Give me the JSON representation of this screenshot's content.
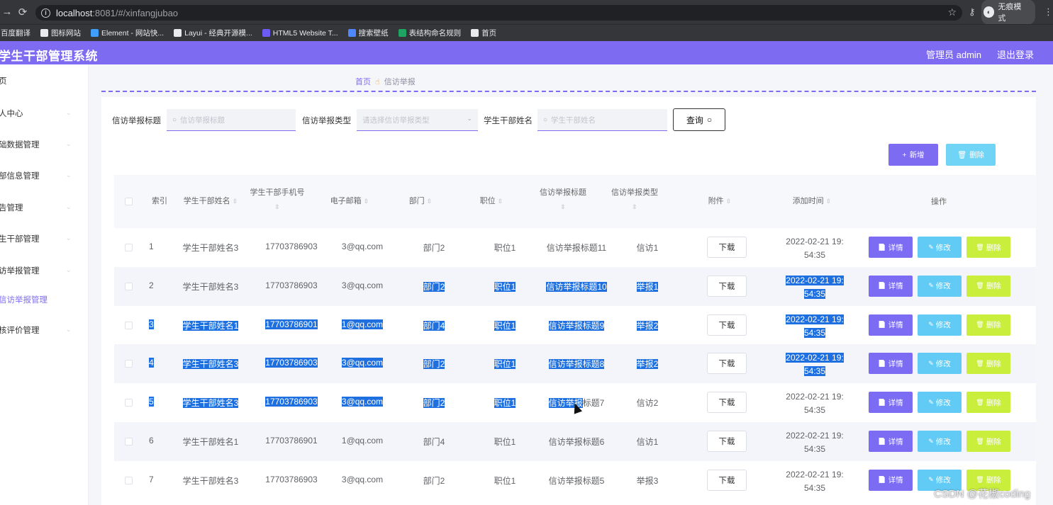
{
  "browser": {
    "url_host": "localhost",
    "url_path": ":8081/#/xinfangjubao",
    "profile_label": "无痕模式",
    "bookmarks": [
      {
        "label": "百度翻译",
        "icon": "translate-icon",
        "color": "#e8eaed"
      },
      {
        "label": "图标网站",
        "icon": "flag-icon",
        "color": "#e8eaed"
      },
      {
        "label": "Element - 网站快...",
        "icon": "element-icon",
        "color": "#409eff"
      },
      {
        "label": "Layui - 经典开源模...",
        "icon": "layui-icon",
        "color": "#e8eaed"
      },
      {
        "label": "HTML5 Website T...",
        "icon": "html5-icon",
        "color": "#6d5cf3"
      },
      {
        "label": "搜索壁纸",
        "icon": "wallpaper-icon",
        "color": "#4f87ff"
      },
      {
        "label": "表结构命名规则",
        "icon": "sheet-icon",
        "color": "#1fa463"
      },
      {
        "label": "首页",
        "icon": "globe-icon",
        "color": "#e8eaed"
      }
    ]
  },
  "header": {
    "title": "学生干部管理系统",
    "admin_label": "管理员 admin",
    "logout_label": "退出登录",
    "color": "#7d6cf2"
  },
  "sidebar": {
    "items": [
      {
        "label": "页",
        "active": false,
        "chevron": false
      },
      {
        "label": "人中心",
        "active": false,
        "chevron": true
      },
      {
        "label": "础数据管理",
        "active": false,
        "chevron": true
      },
      {
        "label": "部信息管理",
        "active": false,
        "chevron": true
      },
      {
        "label": "告管理",
        "active": false,
        "chevron": true
      },
      {
        "label": "生干部管理",
        "active": false,
        "chevron": true
      },
      {
        "label": "访举报管理",
        "active": false,
        "chevron": true
      },
      {
        "label": "信访举报管理",
        "active": true,
        "chevron": false
      },
      {
        "label": "核评价管理",
        "active": false,
        "chevron": true
      }
    ]
  },
  "breadcrumb": {
    "home": "首页",
    "current": "信访举报"
  },
  "filters": {
    "title_label": "信访举报标题",
    "title_placeholder": "信访举报标题",
    "type_label": "信访举报类型",
    "type_placeholder": "请选择信访举报类型",
    "name_label": "学生干部姓名",
    "name_placeholder": "学生干部姓名",
    "query_label": "查询"
  },
  "toolbar": {
    "add_label": "新增",
    "delete_label": "删除"
  },
  "table": {
    "headers": {
      "index": "索引",
      "name": "学生干部姓名",
      "phone": "学生干部手机号",
      "email": "电子邮箱",
      "dept": "部门",
      "position": "职位",
      "title": "信访举报标题",
      "type": "信访举报类型",
      "attachment": "附件",
      "time": "添加时间",
      "ops": "操作"
    },
    "download_label": "下载",
    "detail_label": "详情",
    "edit_label": "修改",
    "delete_label": "删除",
    "rows": [
      {
        "index": "1",
        "name": "学生干部姓名3",
        "phone": "17703786903",
        "email": "3@qq.com",
        "dept": "部门2",
        "position": "职位1",
        "title": "信访举报标题11",
        "type": "信访1",
        "time1": "2022-02-21 19:",
        "time2": "54:35"
      },
      {
        "index": "2",
        "name": "学生干部姓名3",
        "phone": "17703786903",
        "email": "3@qq.com",
        "dept": "部门2",
        "position": "职位1",
        "title": "信访举报标题10",
        "type": "举报1",
        "time1": "2022-02-21 19:",
        "time2": "54:35"
      },
      {
        "index": "3",
        "name": "学生干部姓名1",
        "phone": "17703786901",
        "email": "1@qq.com",
        "dept": "部门4",
        "position": "职位1",
        "title": "信访举报标题9",
        "type": "举报2",
        "time1": "2022-02-21 19:",
        "time2": "54:35"
      },
      {
        "index": "4",
        "name": "学生干部姓名3",
        "phone": "17703786903",
        "email": "3@qq.com",
        "dept": "部门2",
        "position": "职位1",
        "title": "信访举报标题8",
        "type": "举报2",
        "time1": "2022-02-21 19:",
        "time2": "54:35"
      },
      {
        "index": "5",
        "name": "学生干部姓名3",
        "phone": "17703786903",
        "email": "3@qq.com",
        "dept": "部门2",
        "position": "职位1",
        "title": "信访举报标题7",
        "type": "信访2",
        "time1": "2022-02-21 19:",
        "time2": "54:35"
      },
      {
        "index": "6",
        "name": "学生干部姓名1",
        "phone": "17703786901",
        "email": "1@qq.com",
        "dept": "部门4",
        "position": "职位1",
        "title": "信访举报标题6",
        "type": "信访1",
        "time1": "2022-02-21 19:",
        "time2": "54:35"
      },
      {
        "index": "7",
        "name": "学生干部姓名3",
        "phone": "17703786903",
        "email": "3@qq.com",
        "dept": "部门2",
        "position": "职位1",
        "title": "信访举报标题5",
        "type": "举报3",
        "time1": "2022-02-21 19:",
        "time2": "54:35"
      }
    ]
  },
  "watermark": "CSDN @花椒coding"
}
